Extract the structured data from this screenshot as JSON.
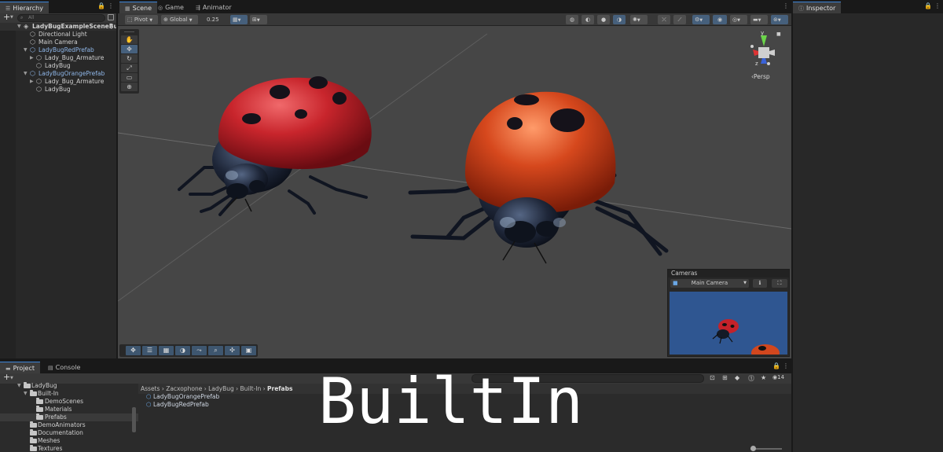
{
  "hierarchy": {
    "tab_label": "Hierarchy",
    "add_label": "+",
    "search_placeholder": "All",
    "items": [
      {
        "label": "LadyBugExampleSceneBu",
        "kind": "scene"
      },
      {
        "label": "Directional Light",
        "kind": "object"
      },
      {
        "label": "Main Camera",
        "kind": "object"
      },
      {
        "label": "LadyBugRedPrefab",
        "kind": "prefab"
      },
      {
        "label": "Lady_Bug_Armature",
        "kind": "object"
      },
      {
        "label": "LadyBug",
        "kind": "object"
      },
      {
        "label": "LadyBugOrangePrefab",
        "kind": "prefab"
      },
      {
        "label": "Lady_Bug_Armature",
        "kind": "object"
      },
      {
        "label": "LadyBug",
        "kind": "object"
      }
    ]
  },
  "scene": {
    "tabs": [
      {
        "label": "Scene",
        "icon": "grid-icon",
        "active": true
      },
      {
        "label": "Game",
        "icon": "gamepad-icon",
        "active": false
      },
      {
        "label": "Animator",
        "icon": "animator-icon",
        "active": false
      }
    ],
    "toolbar": {
      "pivot": "Pivot",
      "global": "Global",
      "snap_value": "0.25"
    },
    "gizmo": {
      "y": "y",
      "z": "z",
      "projection": "Persp"
    },
    "cameras_overlay": {
      "title": "Cameras",
      "selected": "Main Camera"
    }
  },
  "inspector": {
    "tab_label": "Inspector"
  },
  "project": {
    "tabs": [
      {
        "label": "Project",
        "active": true
      },
      {
        "label": "Console",
        "active": false
      }
    ],
    "add_label": "+",
    "asset_count": "14",
    "tree": [
      {
        "label": "LadyBug",
        "indent": 1
      },
      {
        "label": "Built-In",
        "indent": 2
      },
      {
        "label": "DemoScenes",
        "indent": 3
      },
      {
        "label": "Materials",
        "indent": 3
      },
      {
        "label": "Prefabs",
        "indent": 3,
        "selected": true
      },
      {
        "label": "DemoAnimators",
        "indent": 2
      },
      {
        "label": "Documentation",
        "indent": 2
      },
      {
        "label": "Meshes",
        "indent": 2
      },
      {
        "label": "Textures",
        "indent": 2
      }
    ],
    "breadcrumb": [
      "Assets",
      "Zacxophone",
      "LadyBug",
      "Built-In",
      "Prefabs"
    ],
    "assets": [
      "LadyBugOrangePrefab",
      "LadyBugRedPrefab"
    ]
  },
  "overlay_text": "BuiltIn",
  "colors": {
    "accent": "#3d84d7",
    "prefab_text": "#8fb6e8",
    "ladybug_red": "#c4222a",
    "ladybug_orange": "#d2471e",
    "sky": "#2f5691"
  }
}
